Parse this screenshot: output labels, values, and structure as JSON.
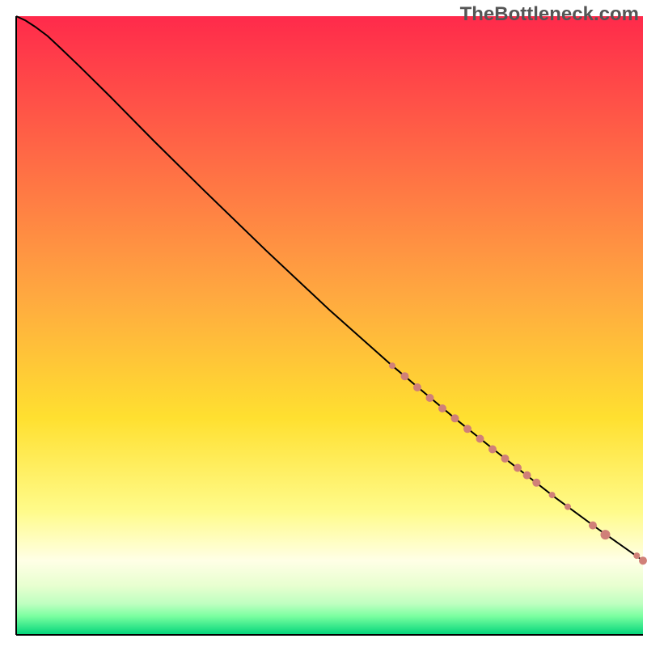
{
  "watermark": "TheBottleneck.com",
  "chart_data": {
    "type": "line",
    "title": "",
    "xlabel": "",
    "ylabel": "",
    "xlim": [
      0,
      100
    ],
    "ylim": [
      0,
      100
    ],
    "grid": false,
    "legend": "none",
    "background": {
      "type": "vertical-gradient",
      "stops": [
        {
          "offset": 0.0,
          "color": "#ff2a4b"
        },
        {
          "offset": 0.45,
          "color": "#ffa840"
        },
        {
          "offset": 0.65,
          "color": "#ffe030"
        },
        {
          "offset": 0.8,
          "color": "#fffb8a"
        },
        {
          "offset": 0.88,
          "color": "#ffffe6"
        },
        {
          "offset": 0.92,
          "color": "#e8ffd0"
        },
        {
          "offset": 0.95,
          "color": "#beffc0"
        },
        {
          "offset": 0.97,
          "color": "#7affa0"
        },
        {
          "offset": 1.0,
          "color": "#00d47a"
        }
      ]
    },
    "series": [
      {
        "name": "curve",
        "type": "line",
        "color": "#000000",
        "x": [
          0.0,
          1.5,
          3.0,
          5.0,
          7.0,
          10.0,
          15.0,
          22.0,
          30.0,
          40.0,
          50.0,
          60.0,
          70.0,
          78.0,
          86.0,
          93.0,
          100.0
        ],
        "y": [
          100.0,
          99.3,
          98.3,
          96.8,
          94.9,
          92.0,
          87.0,
          79.8,
          71.8,
          62.0,
          52.5,
          43.5,
          35.0,
          28.5,
          22.2,
          17.0,
          12.0
        ]
      },
      {
        "name": "markers",
        "type": "scatter",
        "color": "#d08078",
        "x": [
          60.0,
          62.0,
          64.0,
          66.0,
          68.0,
          70.0,
          72.0,
          74.0,
          76.0,
          78.0,
          80.0,
          81.5,
          83.0,
          85.5,
          88.0,
          92.0,
          94.0,
          99.0,
          100.0
        ],
        "y": [
          43.5,
          41.8,
          40.0,
          38.3,
          36.6,
          35.0,
          33.3,
          31.7,
          30.0,
          28.5,
          27.0,
          25.8,
          24.6,
          22.6,
          20.7,
          17.7,
          16.2,
          12.8,
          12.0
        ],
        "r": [
          4,
          5,
          5,
          5,
          5,
          5,
          5,
          5,
          5,
          5,
          5,
          5,
          5,
          4,
          4,
          5,
          6,
          4,
          5
        ]
      }
    ]
  }
}
